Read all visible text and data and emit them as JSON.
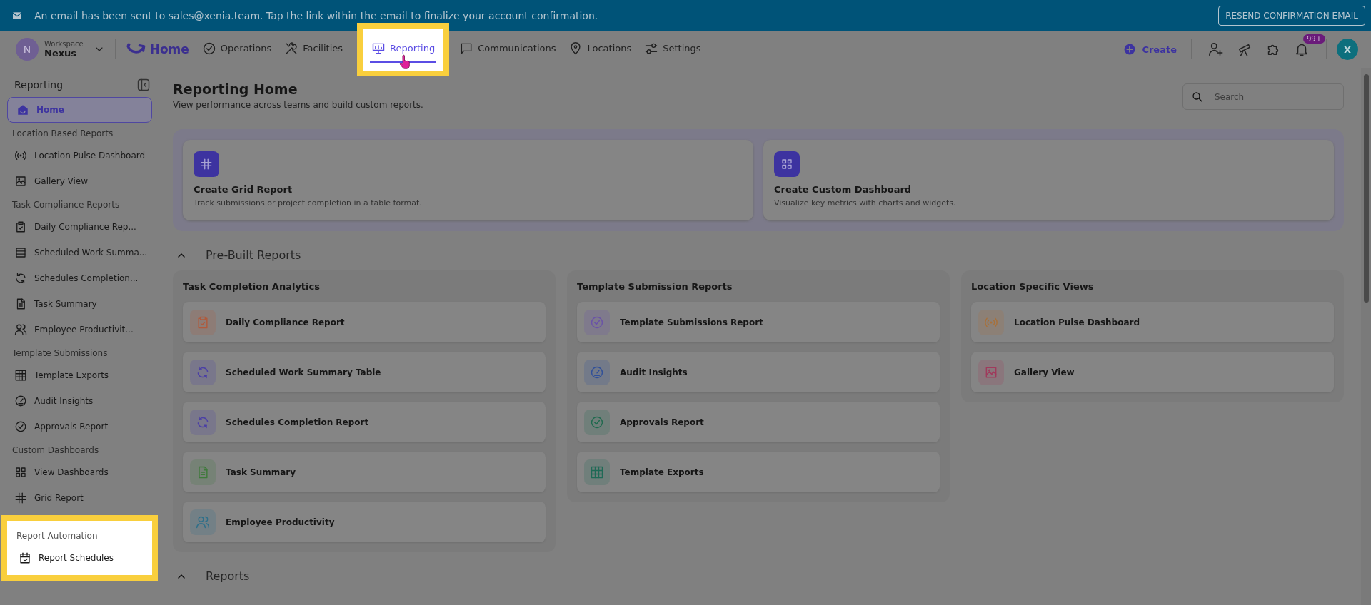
{
  "banner": {
    "message": "An email has been sent to sales@xenia.team. Tap the link within the email to finalize your account confirmation.",
    "button": "RESEND CONFIRMATION EMAIL"
  },
  "workspace": {
    "initial": "N",
    "label": "Workspace",
    "name": "Nexus"
  },
  "nav": [
    {
      "kind": "logo",
      "label": "Home"
    },
    {
      "kind": "tab",
      "label": "Operations",
      "selected": false,
      "highlighted": false
    },
    {
      "kind": "tab",
      "label": "Facilities",
      "selected": false,
      "highlighted": false
    },
    {
      "kind": "tab",
      "label": "Reporting",
      "selected": true,
      "highlighted": true
    },
    {
      "kind": "tab",
      "label": "Communications",
      "selected": false,
      "highlighted": false
    },
    {
      "kind": "tab",
      "label": "Locations",
      "selected": false,
      "highlighted": false
    },
    {
      "kind": "tab",
      "label": "Settings",
      "selected": false,
      "highlighted": false
    }
  ],
  "actions": {
    "create": "Create",
    "notifications": "99+",
    "avatar": "X"
  },
  "sidebar": {
    "title": "Reporting",
    "home": {
      "label": "Home",
      "selected": true
    },
    "sections": [
      {
        "label": "Location Based Reports",
        "highlighted": false,
        "items": [
          {
            "label": "Location Pulse Dashboard",
            "selected": false
          },
          {
            "label": "Gallery View",
            "selected": false
          }
        ]
      },
      {
        "label": "Task Compliance Reports",
        "highlighted": false,
        "items": [
          {
            "label": "Daily Compliance Rep...",
            "selected": false
          },
          {
            "label": "Scheduled Work Summa...",
            "selected": false
          },
          {
            "label": "Schedules Completion...",
            "selected": false
          },
          {
            "label": "Task Summary",
            "selected": false
          },
          {
            "label": "Employee Productivit...",
            "selected": false
          }
        ]
      },
      {
        "label": "Template Submissions",
        "highlighted": false,
        "items": [
          {
            "label": "Template Exports",
            "selected": false
          },
          {
            "label": "Audit Insights",
            "selected": false
          },
          {
            "label": "Approvals Report",
            "selected": false
          }
        ]
      },
      {
        "label": "Custom Dashboards",
        "highlighted": false,
        "items": [
          {
            "label": "View Dashboards",
            "selected": false
          },
          {
            "label": "Grid Report",
            "selected": false
          }
        ]
      },
      {
        "label": "Report Automation",
        "highlighted": true,
        "items": [
          {
            "label": "Report Schedules",
            "selected": false
          }
        ]
      }
    ]
  },
  "page": {
    "title": "Reporting Home",
    "subtitle": "View performance across teams and build custom reports.",
    "search": {
      "placeholder": "Search"
    }
  },
  "create_cards": [
    {
      "title": "Create Grid Report",
      "description": "Track submissions or project completion in a table format."
    },
    {
      "title": "Create Custom Dashboard",
      "description": "Visualize key metrics with charts and widgets."
    }
  ],
  "prebuilt": {
    "title": "Pre-Built Reports",
    "expanded": true,
    "columns": [
      {
        "title": "Task Completion Analytics",
        "items": [
          {
            "label": "Daily Compliance Report",
            "color": "#b05a3c"
          },
          {
            "label": "Scheduled Work Summary Table",
            "color": "#4b3fa6"
          },
          {
            "label": "Schedules Completion Report",
            "color": "#4b3fa6"
          },
          {
            "label": "Task Summary",
            "color": "#3e7a3a"
          },
          {
            "label": "Employee Productivity",
            "color": "#2d6f8a"
          }
        ]
      },
      {
        "title": "Template Submission Reports",
        "items": [
          {
            "label": "Template Submissions Report",
            "color": "#6a52a8"
          },
          {
            "label": "Audit Insights",
            "color": "#2f4f9a"
          },
          {
            "label": "Approvals Report",
            "color": "#1f6a4e"
          },
          {
            "label": "Template Exports",
            "color": "#1f6a56"
          }
        ]
      },
      {
        "title": "Location Specific Views",
        "items": [
          {
            "label": "Location Pulse Dashboard",
            "color": "#a8703a"
          },
          {
            "label": "Gallery View",
            "color": "#a03a5c"
          }
        ]
      }
    ]
  },
  "reports": {
    "title": "Reports",
    "expanded": true
  }
}
